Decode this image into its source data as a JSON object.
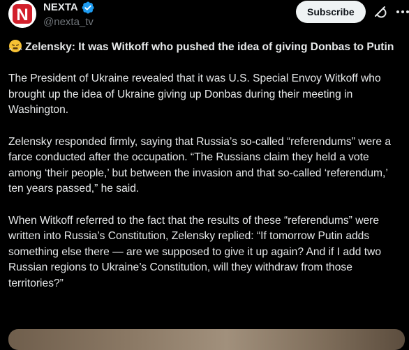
{
  "account": {
    "display_name": "NEXTA",
    "handle": "@nexta_tv",
    "verified": true,
    "avatar_icon": "nexta-logo",
    "avatar_letter": "N"
  },
  "actions": {
    "subscribe_label": "Subscribe",
    "grok_icon": "grok-icon",
    "more_icon": "more-icon"
  },
  "post": {
    "headline_emoji": "😤",
    "headline": "Zelensky: It was Witkoff who pushed the idea of giving Donbas to Putin",
    "paragraphs": [
      "The President of Ukraine revealed that it was U.S. Special Envoy Witkoff who brought up the idea of Ukraine giving up Donbas during their meeting in Washington.",
      "Zelensky responded firmly, saying that Russia’s so-called “referendums” were a farce conducted after the occupation. “The Russians claim they held a vote among ‘their people,’ but between the invasion and that so-called ‘referendum,’ ten years passed,” he said.",
      "When Witkoff referred to the fact that the results of these “referendums” were written into Russia’s Constitution, Zelensky replied: “If tomorrow Putin adds something else there — are we supposed to give it up again? And if I add two Russian regions to Ukraine’s Constitution, will they withdraw from those territories?”"
    ]
  },
  "colors": {
    "background": "#000000",
    "text_primary": "#e7e9ea",
    "text_secondary": "#71767b",
    "verified_blue": "#1d9bf0",
    "brand_red": "#d21f2b"
  }
}
